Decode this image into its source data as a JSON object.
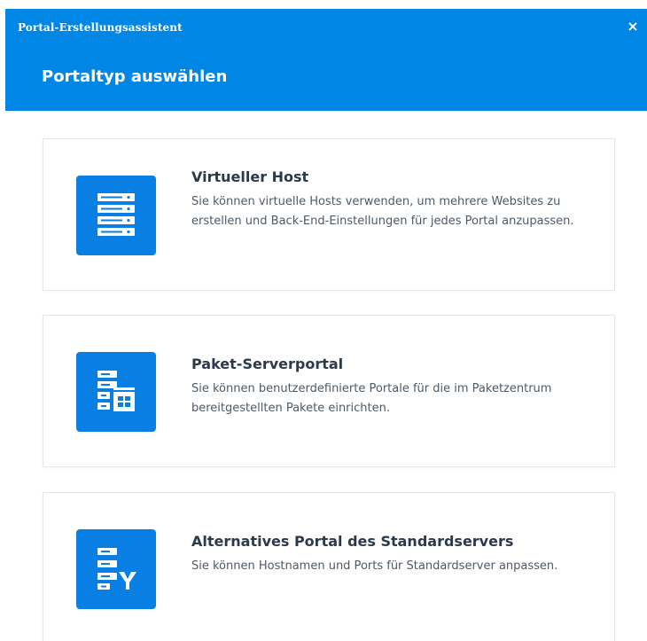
{
  "window": {
    "title": "Portal-Erstellungsassistent",
    "close_label": "×"
  },
  "header": {
    "step_title": "Portaltyp auswählen"
  },
  "options": [
    {
      "icon": "server-list-icon",
      "title": "Virtueller Host",
      "description": "Sie können virtuelle Hosts verwenden, um mehrere Websites zu erstellen und Back-End-Einstellungen für jedes Portal anzupassen."
    },
    {
      "icon": "package-server-icon",
      "title": "Paket-Serverportal",
      "description": "Sie können benutzerdefinierte Portale für die im Paketzentrum bereitgestellten Pakete einrichten."
    },
    {
      "icon": "server-alternate-icon",
      "title": "Alternatives Portal des Standardservers",
      "description": "Sie können Hostnamen und Ports für Standardserver anpassen."
    }
  ],
  "colors": {
    "header_bg": "#0086e5",
    "icon_bg": "#0a7fe3",
    "heading_text": "#2b3a4a",
    "body_text": "#4c5a68"
  }
}
